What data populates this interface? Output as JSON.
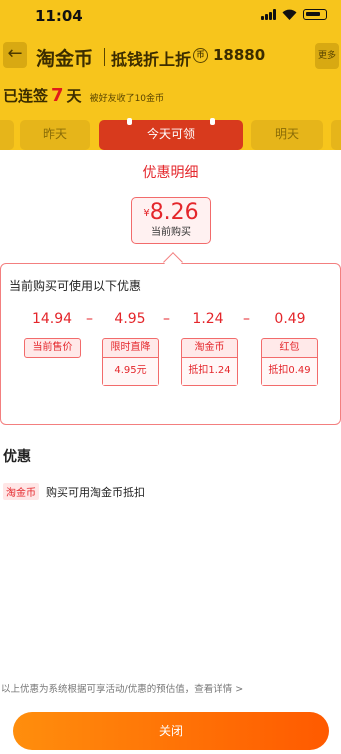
{
  "status_bar": {
    "time": "11:04",
    "icons": [
      "signal-icon",
      "wifi-icon",
      "battery-icon"
    ]
  },
  "navbar": {
    "brand": "淘金币",
    "slogan": "抵钱折上折",
    "coin_icon": "币",
    "coin_count": "18880",
    "more_label": "更多"
  },
  "signin": {
    "prefix": "已连签",
    "days": "7",
    "unit": "天",
    "note": "被好友收了10金币"
  },
  "day_tabs": [
    {
      "label": ""
    },
    {
      "label": "昨天"
    },
    {
      "label": "今天可领"
    },
    {
      "label": "明天"
    },
    {
      "label": ""
    }
  ],
  "sheet": {
    "title": "优惠明细",
    "price": {
      "symbol": "¥",
      "value": "8.26",
      "label": "当前购买"
    },
    "detail_title": "当前购买可使用以下优惠",
    "operators": [
      "–",
      "–",
      "–"
    ],
    "items": [
      {
        "amount": "14.94",
        "name": "当前售价",
        "sub": ""
      },
      {
        "amount": "4.95",
        "name": "限时直降",
        "sub": "4.95元"
      },
      {
        "amount": "1.24",
        "name": "淘金币",
        "sub": "抵扣1.24"
      },
      {
        "amount": "0.49",
        "name": "红包",
        "sub": "抵扣0.49"
      }
    ],
    "section_title": "优惠",
    "promo": {
      "tag": "淘金币",
      "desc": "购买可用淘金币抵扣"
    },
    "footnote": "以上优惠为系统根据可享活动/优惠的预估值，查看详情 >",
    "close_label": "关闭"
  },
  "colors": {
    "accent_red": "#e4262b",
    "bg_yellow": "#f7c51c",
    "button_orange": "#ff7a0a"
  }
}
